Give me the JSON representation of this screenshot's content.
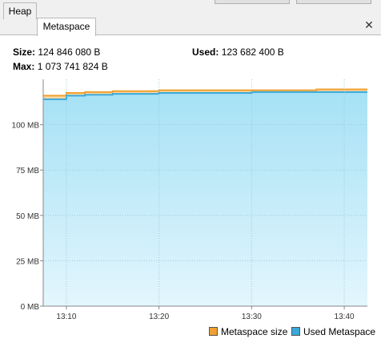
{
  "tabs": [
    {
      "label": "Heap",
      "active": false
    },
    {
      "label": "Metaspace",
      "active": true
    }
  ],
  "close_icon": "close-icon",
  "info": {
    "size_label": "Size:",
    "size_value": "124 846 080 B",
    "used_label": "Used:",
    "used_value": "123 682 400 B",
    "max_label": "Max:",
    "max_value": "1 073 741 824 B"
  },
  "chart_data": {
    "type": "area",
    "x_ticks": [
      "13:10",
      "13:20",
      "13:30",
      "13:40"
    ],
    "y_ticks": [
      "0 MB",
      "25 MB",
      "50 MB",
      "75 MB",
      "100 MB"
    ],
    "ylim": [
      0,
      125
    ],
    "grid": true,
    "legend_position": "bottom-right",
    "series": [
      {
        "name": "Metaspace size",
        "color": "#f0a030",
        "x": [
          "13:08",
          "13:10",
          "13:12",
          "13:15",
          "13:20",
          "13:30",
          "13:37",
          "13:42"
        ],
        "values": [
          116,
          117.5,
          118,
          118.5,
          119,
          119,
          119.5,
          119.5
        ]
      },
      {
        "name": "Used Metaspace",
        "color": "#3aa9d8",
        "x": [
          "13:08",
          "13:10",
          "13:12",
          "13:15",
          "13:20",
          "13:30",
          "13:37",
          "13:42"
        ],
        "values": [
          114,
          116,
          116.5,
          117,
          117.5,
          118,
          118,
          118
        ]
      }
    ]
  }
}
